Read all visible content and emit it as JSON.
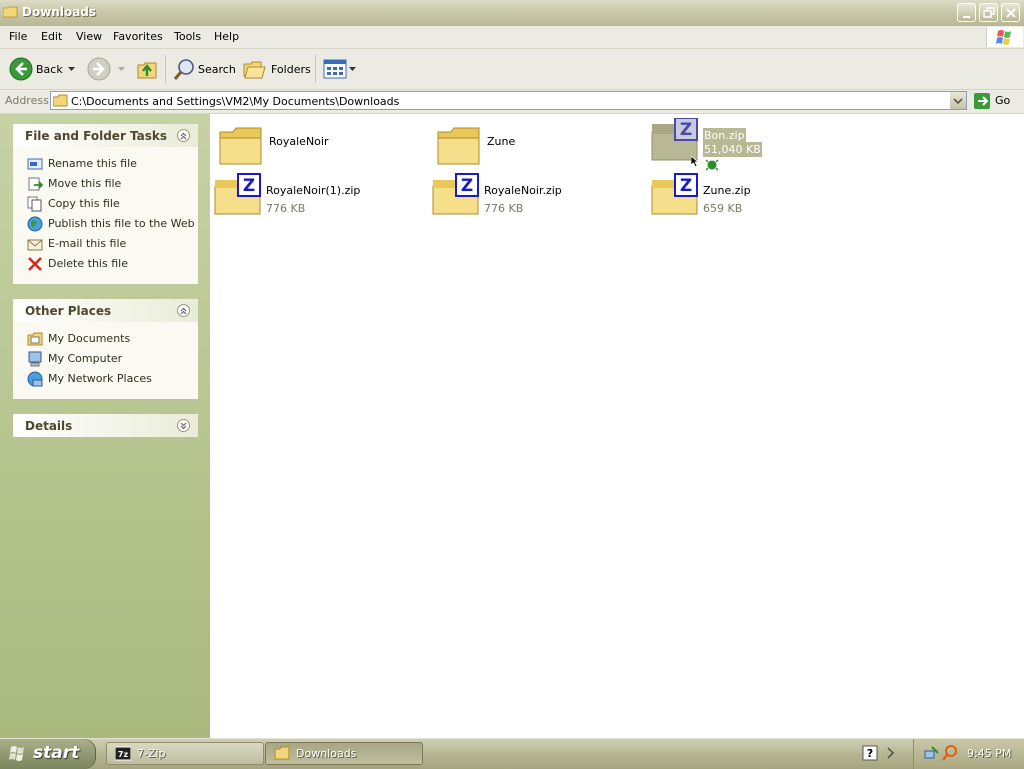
{
  "window": {
    "title": "Downloads"
  },
  "menu": [
    "File",
    "Edit",
    "View",
    "Favorites",
    "Tools",
    "Help"
  ],
  "toolbar": {
    "back": "Back",
    "search": "Search",
    "folders": "Folders"
  },
  "address": {
    "label": "Address",
    "path": "C:\\Documents and Settings\\VM2\\My Documents\\Downloads",
    "go": "Go"
  },
  "tasks": {
    "title": "File and Folder Tasks",
    "items": [
      {
        "label": "Rename this file",
        "icon": "rename-icon"
      },
      {
        "label": "Move this file",
        "icon": "move-icon"
      },
      {
        "label": "Copy this file",
        "icon": "copy-icon"
      },
      {
        "label": "Publish this file to the Web",
        "icon": "globe-icon"
      },
      {
        "label": "E-mail this file",
        "icon": "email-icon"
      },
      {
        "label": "Delete this file",
        "icon": "delete-icon"
      }
    ]
  },
  "places": {
    "title": "Other Places",
    "items": [
      {
        "label": "My Documents",
        "icon": "my-documents-icon"
      },
      {
        "label": "My Computer",
        "icon": "my-computer-icon"
      },
      {
        "label": "My Network Places",
        "icon": "network-places-icon"
      }
    ]
  },
  "details": {
    "title": "Details"
  },
  "files": [
    {
      "name": "RoyaleNoir",
      "size": "",
      "type": "folder"
    },
    {
      "name": "Zune",
      "size": "",
      "type": "folder"
    },
    {
      "name": "Bon.zip",
      "size": "51,040 KB",
      "type": "zip",
      "selected": true
    },
    {
      "name": "RoyaleNoir(1).zip",
      "size": "776 KB",
      "type": "zip"
    },
    {
      "name": "RoyaleNoir.zip",
      "size": "776 KB",
      "type": "zip"
    },
    {
      "name": "Zune.zip",
      "size": "659 KB",
      "type": "zip"
    }
  ],
  "taskbar": {
    "start": "start",
    "tasks": [
      {
        "label": "7-Zip",
        "active": false
      },
      {
        "label": "Downloads",
        "active": true
      }
    ],
    "clock": "9:45 PM"
  },
  "colors": {
    "selection": "#b8b895",
    "taskpane": "#b8c593",
    "title_text": "#ffffff"
  }
}
